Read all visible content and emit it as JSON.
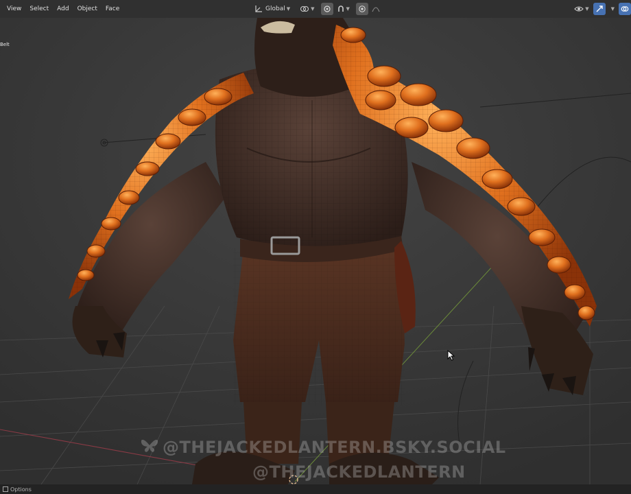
{
  "header": {
    "menus": [
      "View",
      "Select",
      "Add",
      "Object",
      "Face"
    ],
    "transform_orientation": "Global"
  },
  "viewport": {
    "object_label": "Belt",
    "watermark_line1": "@THEJACKEDLANTERN.BSKY.SOCIAL",
    "watermark_line2": "@THEJACKEDLANTERN"
  },
  "status_bar": {
    "options_label": "Options"
  },
  "colors": {
    "header_bg": "#303030",
    "viewport_bg": "#3a3a3a",
    "accent_blue": "#4772b3",
    "scales_orange": "#e0701e",
    "body_dark": "#3b2a22"
  },
  "icons": [
    "orientation-icon",
    "pivot-icon",
    "snap-icon",
    "proportional-edit-icon",
    "falloff-icon",
    "overlay-icon",
    "gizmo-icon",
    "viewport-shading-icon",
    "cursor-arrow-icon",
    "butterfly-icon"
  ]
}
